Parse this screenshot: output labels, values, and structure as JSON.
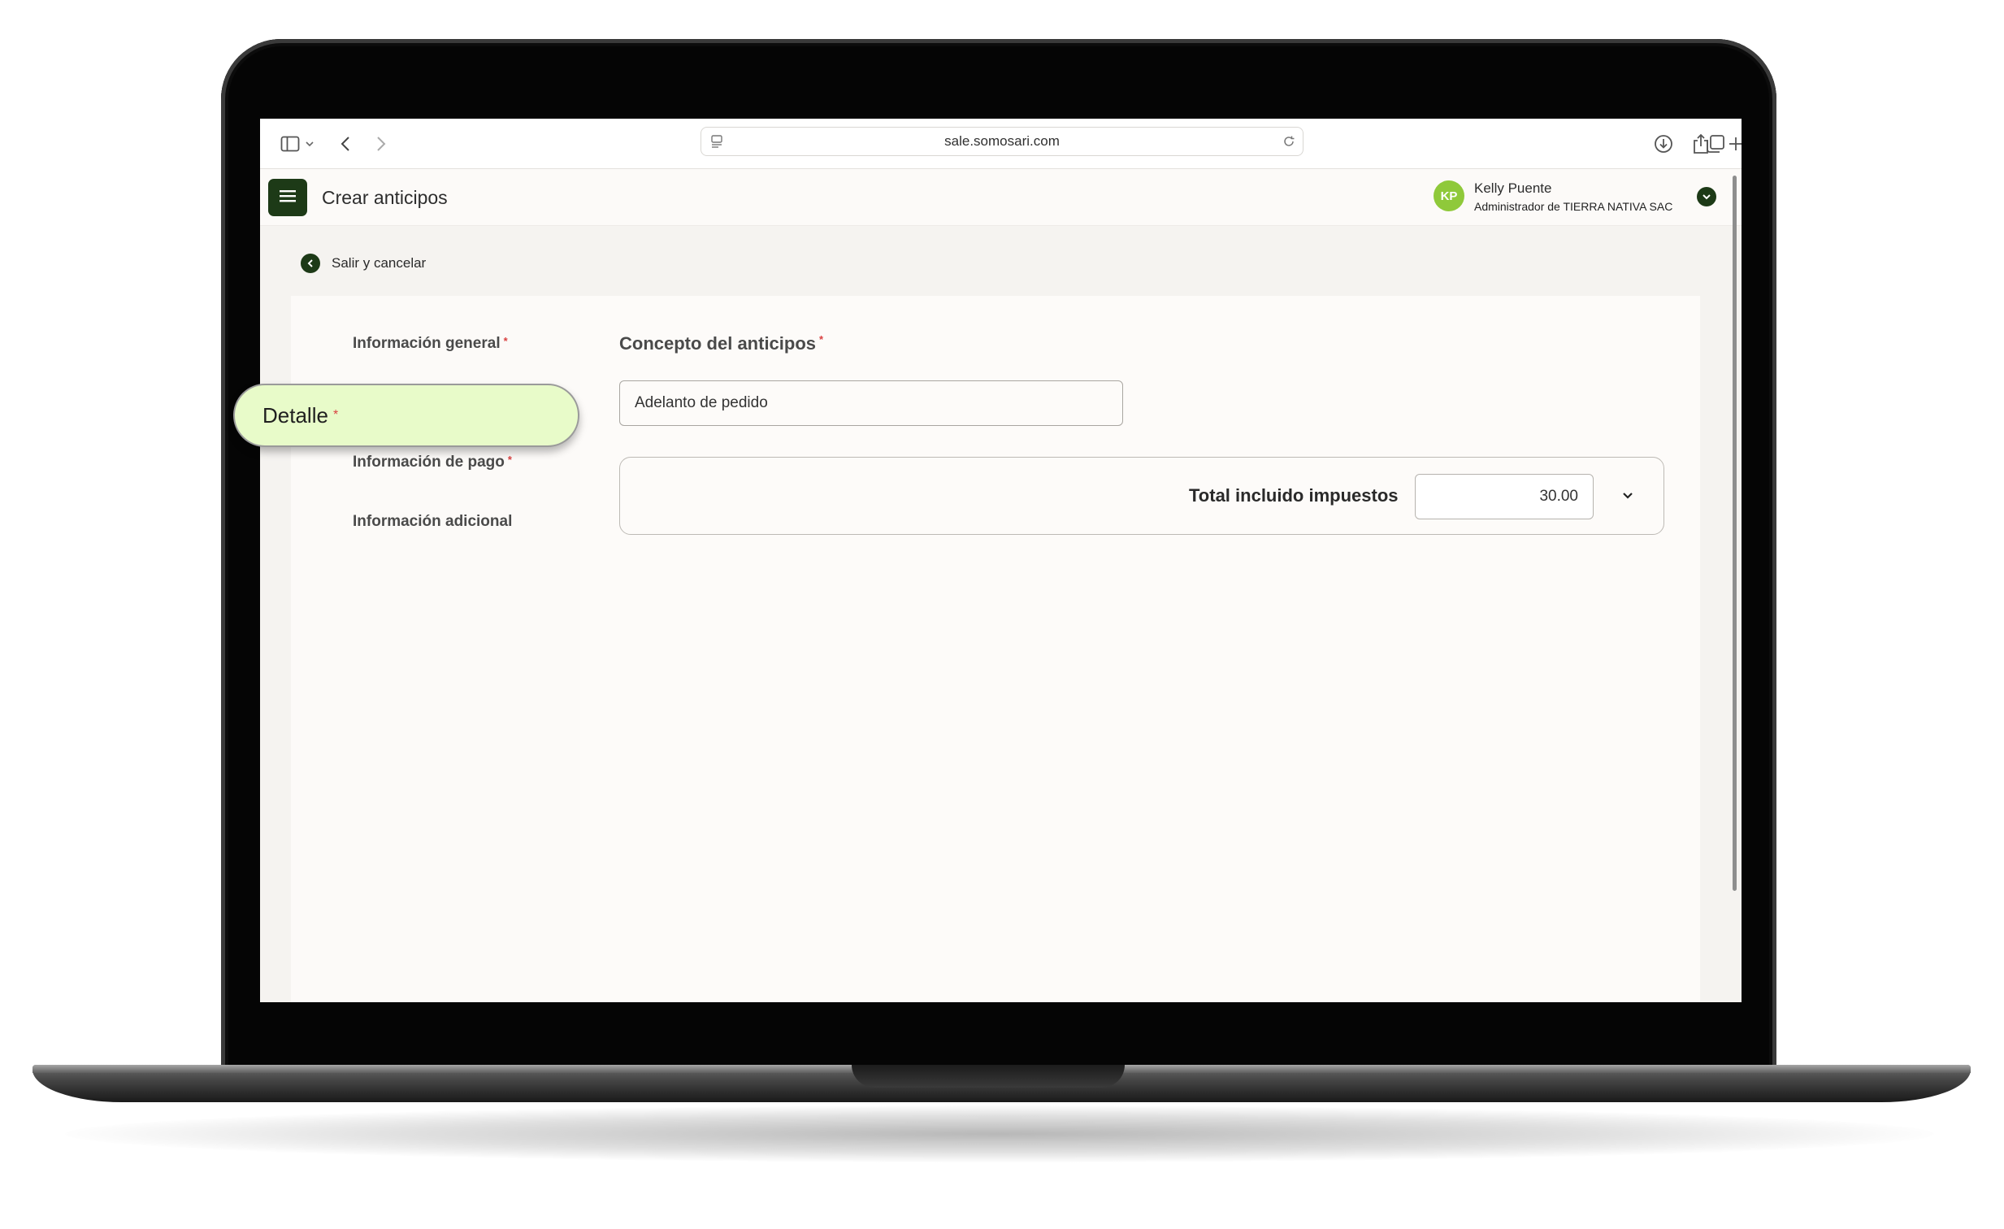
{
  "browser": {
    "url": "sale.somosari.com"
  },
  "header": {
    "title": "Crear anticipos",
    "user": {
      "initials": "KP",
      "name": "Kelly Puente",
      "role": "Administrador de TIERRA NATIVA SAC"
    }
  },
  "back_link": {
    "label": "Salir y cancelar"
  },
  "nav": {
    "items": [
      {
        "label": "Información general",
        "required": "*"
      },
      {
        "label": "Detalle",
        "required": "*"
      },
      {
        "label": "Información de pago",
        "required": "*"
      },
      {
        "label": "Información adicional"
      }
    ]
  },
  "form": {
    "concept_label": "Concepto del anticipos",
    "concept_required": "*",
    "concept_value": "Adelanto de pedido",
    "total_label": "Total incluido impuestos",
    "total_value": "30.00"
  },
  "colors": {
    "brand_dark_green": "#1d3a17",
    "avatar_green": "#8fc93a",
    "highlight": "#e8fbc9",
    "required": "#d94141"
  }
}
